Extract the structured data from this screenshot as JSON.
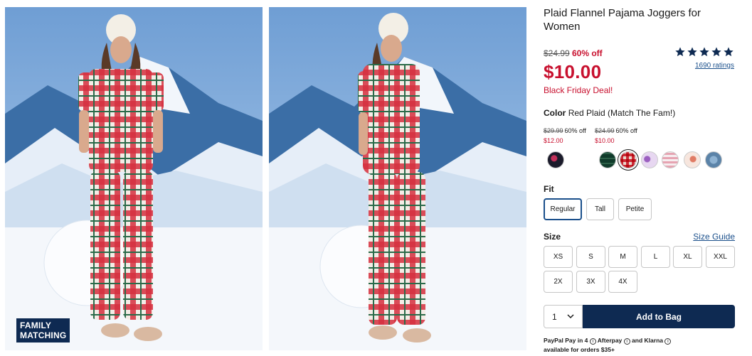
{
  "product": {
    "title": "Plaid Flannel Pajama Joggers for Women",
    "original_price": "$24.99",
    "discount": "60% off",
    "price": "$10.00",
    "deal_text": "Black Friday Deal!",
    "rating": 5,
    "ratings_count": "1690 ratings"
  },
  "gallery": {
    "badge_line1": "FAMILY",
    "badge_line2": "MATCHING"
  },
  "color": {
    "label": "Color",
    "selected": "Red Plaid (Match The Fam!)",
    "variants": [
      {
        "old": "$29.99",
        "off": "60% off",
        "new": "$12.00"
      },
      {
        "old": "$24.99",
        "off": "60% off",
        "new": "$10.00"
      }
    ],
    "swatch_names": [
      "black-floral",
      "green-plaid",
      "red-plaid",
      "purple-print",
      "pink-stripe",
      "peach-print",
      "blue-print"
    ]
  },
  "fit": {
    "label": "Fit",
    "options": [
      "Regular",
      "Tall",
      "Petite"
    ],
    "selected": "Regular"
  },
  "size": {
    "label": "Size",
    "guide": "Size Guide",
    "options": [
      "XS",
      "S",
      "M",
      "L",
      "XL",
      "XXL",
      "2X",
      "3X",
      "4X"
    ]
  },
  "cart": {
    "quantity": "1",
    "add_label": "Add to Bag"
  },
  "payment": {
    "line1_a": "PayPal Pay in 4",
    "line1_b": "Afterpay",
    "line1_c": "and",
    "line1_d": "Klarna",
    "line2": "available for orders $35+"
  },
  "colors": {
    "navy": "#0e2a52",
    "sale_red": "#c8102e",
    "link_blue": "#1a4f8b"
  }
}
